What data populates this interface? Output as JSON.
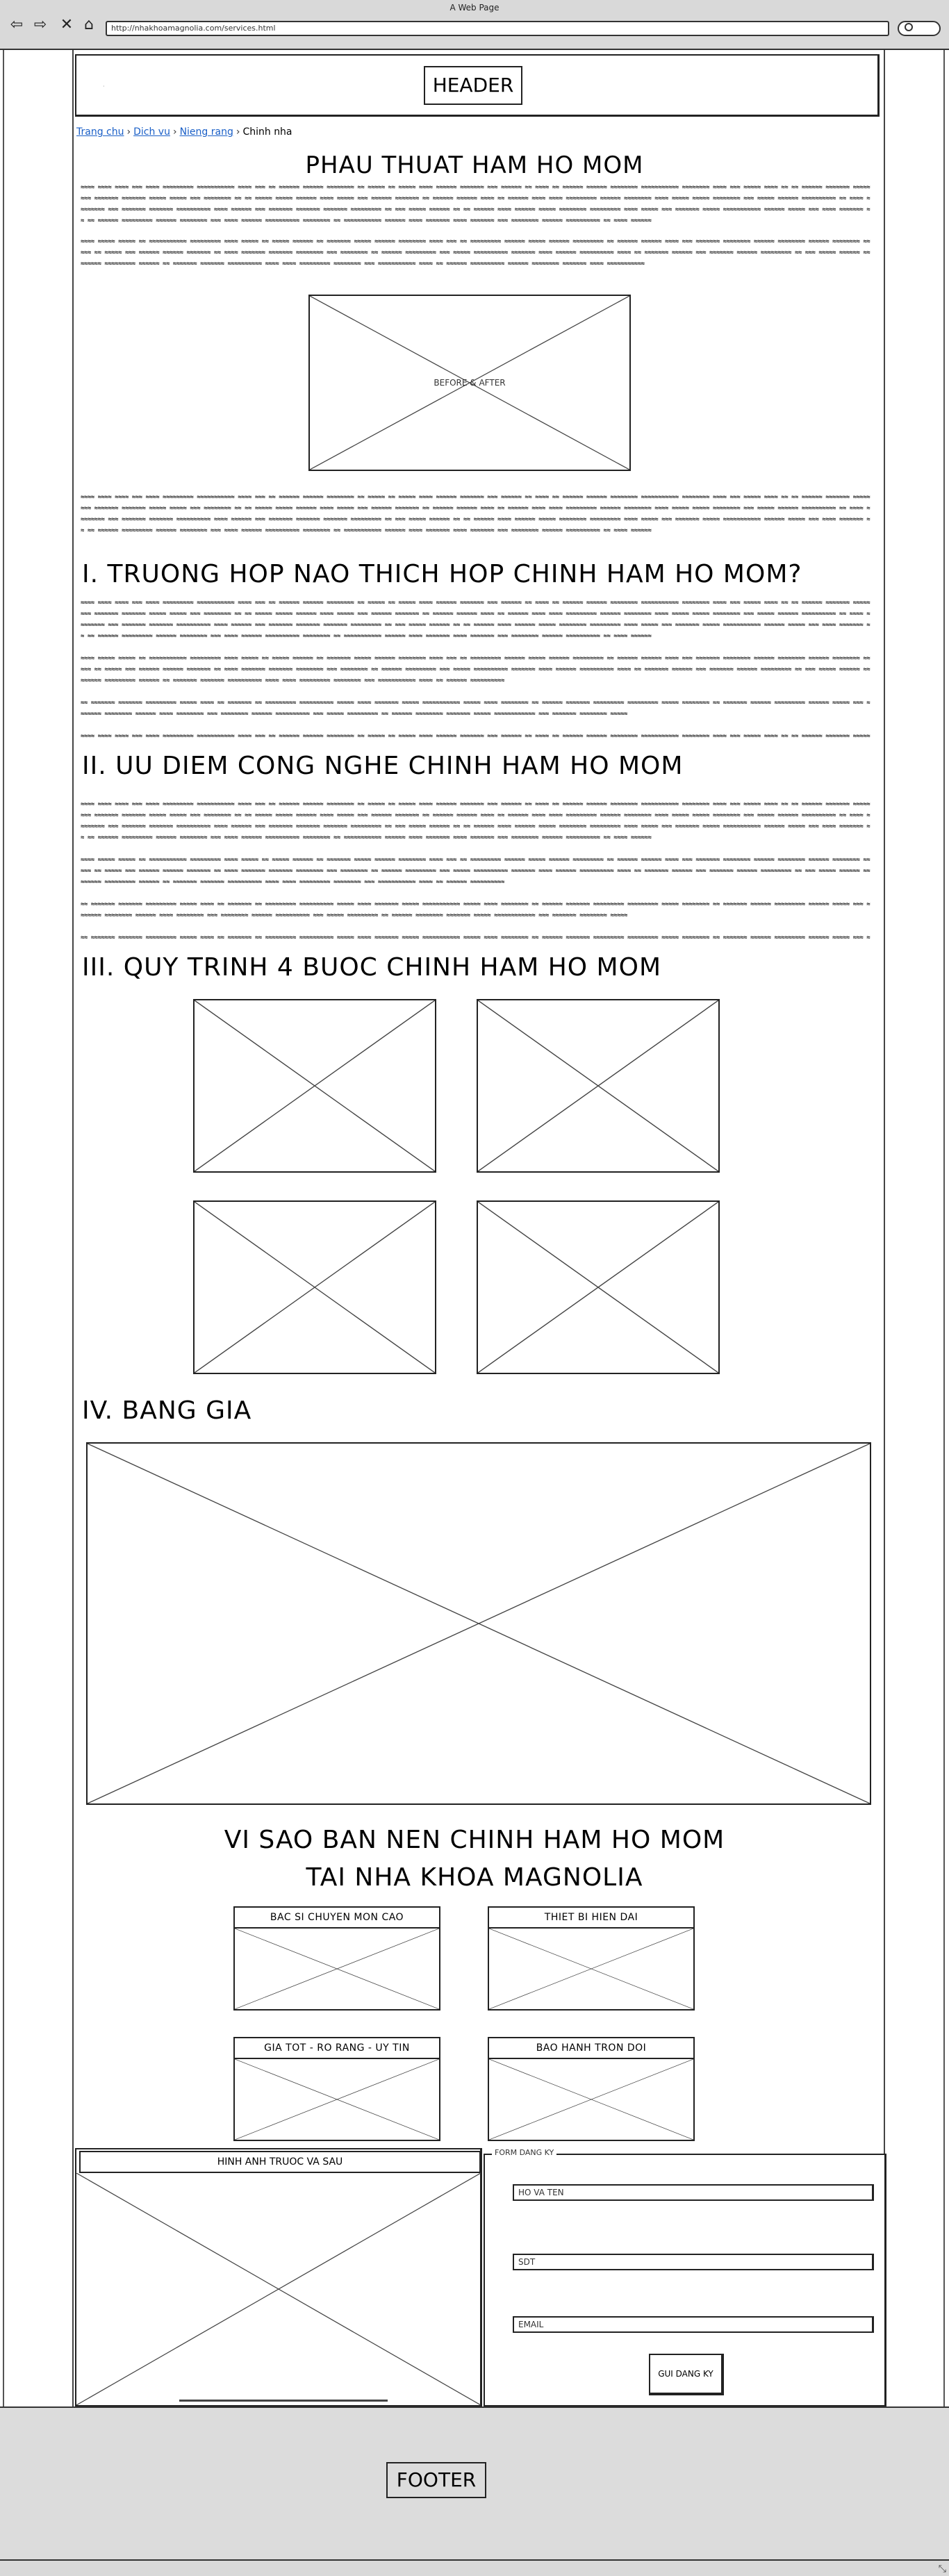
{
  "browser": {
    "window_title": "A Web Page",
    "url": "http://nhakhoamagnolia.com/services.html"
  },
  "header": {
    "label": "HEADER"
  },
  "breadcrumb": {
    "items": [
      "Trang chu",
      "Dich vu",
      "Nieng rang"
    ],
    "current": "Chinh nha"
  },
  "main": {
    "title": "PHAU THUAT HAM HO MOM",
    "before_after_label": "BEFORE & AFTER",
    "sections": [
      "I. TRUONG HOP NAO THICH HOP CHINH HAM HO MOM?",
      "II. UU DIEM CONG NGHE CHINH HAM HO MOM",
      "III. QUY TRINH 4 BUOC CHINH HAM HO MOM",
      "IV. BANG GIA"
    ]
  },
  "why": {
    "title_line1": "VI SAO BAN NEN CHINH HAM HO MOM",
    "title_line2": "TAI NHA KHOA MAGNOLIA",
    "cards": [
      "BAC SI CHUYEN MON CAO",
      "THIET BI HIEN DAI",
      "GIA TOT - RO RANG - UY TIN",
      "BAO HANH TRON DOI"
    ]
  },
  "gallery": {
    "title": "HINH ANH TRUOC VA SAU"
  },
  "form": {
    "legend": "FORM DANG KY",
    "name_placeholder": "HO VA TEN",
    "phone_placeholder": "SDT",
    "email_placeholder": "EMAIL",
    "submit_label": "GUI DANG KY"
  },
  "footer": {
    "label": "FOOTER"
  },
  "icons": [
    "back-arrow-icon",
    "forward-arrow-icon",
    "close-icon",
    "home-icon",
    "search-icon",
    "resize-grip-icon"
  ]
}
